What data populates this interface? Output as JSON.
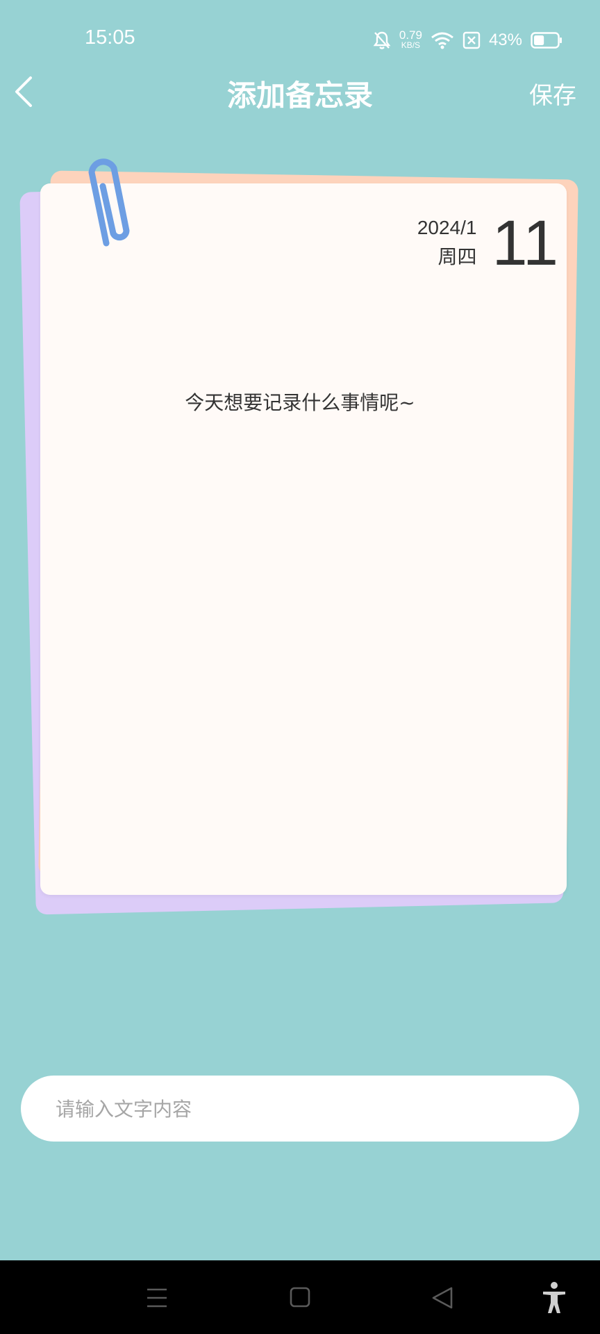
{
  "status_bar": {
    "time": "15:05",
    "net_speed_value": "0.79",
    "net_speed_unit": "KB/S",
    "battery_percent": "43%",
    "battery_level": 0.43
  },
  "header": {
    "title": "添加备忘录",
    "save_label": "保存"
  },
  "memo": {
    "year_month": "2024/1",
    "weekday": "周四",
    "day": "11",
    "prompt": "今天想要记录什么事情呢~"
  },
  "input": {
    "placeholder": "请输入文字内容",
    "value": ""
  },
  "colors": {
    "background": "#97d2d3",
    "paper": "#fffaf7",
    "paper_back_purple": "#dcccf8",
    "paper_back_peach": "#fdd3bc",
    "paperclip": "#6d9ee3"
  },
  "icons": [
    "mute-bell-icon",
    "wifi-icon",
    "sim-x-icon",
    "battery-icon",
    "back-arrow-icon",
    "paperclip-icon",
    "menu-icon",
    "home-icon",
    "back-triangle-icon",
    "accessibility-icon"
  ]
}
